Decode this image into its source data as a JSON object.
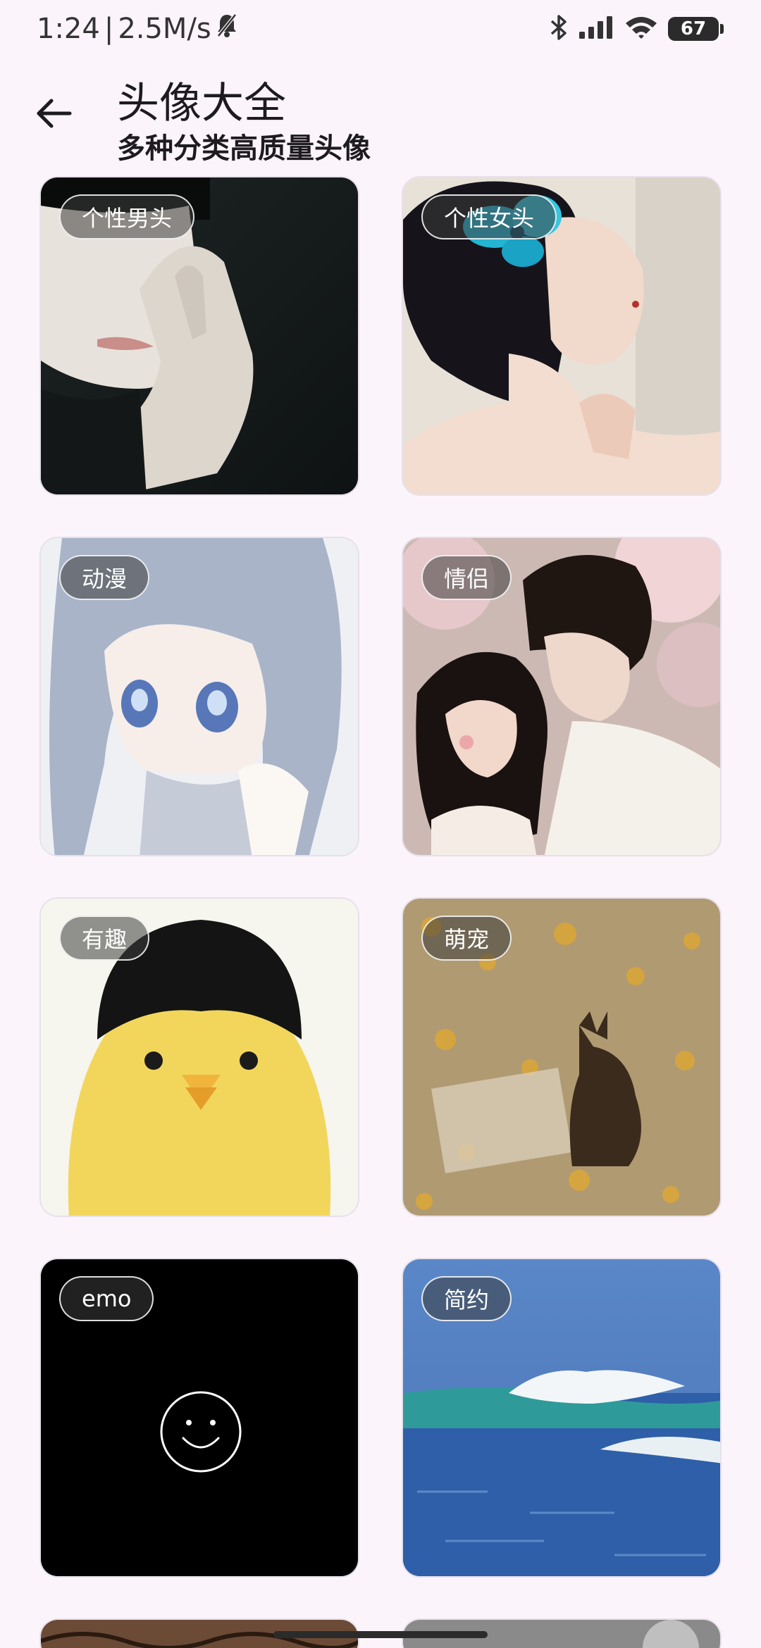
{
  "status_bar": {
    "time": "1:24",
    "separator": "|",
    "speed": "2.5M/s",
    "battery": "67",
    "icons": [
      "bell-off-icon",
      "bluetooth-icon",
      "signal-icon",
      "wifi-icon",
      "battery-icon"
    ]
  },
  "header": {
    "back_icon": "arrow-left-icon",
    "title": "头像大全",
    "subtitle": "多种分类高质量头像"
  },
  "categories": [
    {
      "label": "个性男头"
    },
    {
      "label": "个性女头"
    },
    {
      "label": "动漫"
    },
    {
      "label": "情侣"
    },
    {
      "label": "有趣"
    },
    {
      "label": "萌宠"
    },
    {
      "label": "emo"
    },
    {
      "label": "简约"
    }
  ],
  "colors": {
    "background": "#fbf5fb",
    "badge_bg": "#3c3c3c",
    "text": "#1d1b20"
  }
}
